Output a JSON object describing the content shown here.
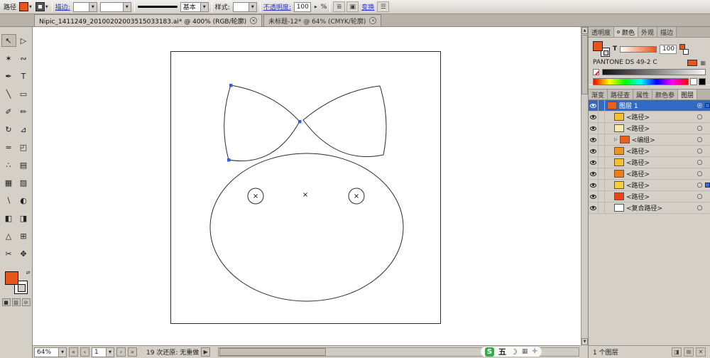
{
  "colors": {
    "accent": "#e8551a",
    "selection": "#316ac5",
    "anchor": "#2f62d2",
    "sogou_green": "#2fae47"
  },
  "icons": {
    "dd": "▼",
    "up": "▲",
    "down": "▼",
    "first": "«",
    "prev": "‹",
    "next": "›",
    "last": "»",
    "flyout": "▶",
    "swap": "⇄",
    "close": "×",
    "target": "○",
    "target_selected": "◎",
    "twisty": "▷",
    "grid": "▦",
    "gripper": "⋯",
    "spinner": "▶"
  },
  "control_bar": {
    "context_label": "路径",
    "stroke_link": "描边:",
    "brush_value": "基本",
    "style_label": "样式:",
    "opacity_link": "不透明度:",
    "opacity_value": "100",
    "opacity_unit": "%",
    "transform_link": "变换",
    "cb_icons": [
      {
        "name": "select-similar-icon",
        "glyph": "≣"
      },
      {
        "name": "document-setup-icon",
        "glyph": "▣"
      },
      {
        "name": "preferences-icon",
        "glyph": "☰"
      }
    ]
  },
  "doc_tabs": [
    {
      "label": "Nipic_1411249_20100202003515033183.ai* @ 400% (RGB/轮廓)",
      "active": true
    },
    {
      "label": "未标题-12* @ 64% (CMYK/轮廓)",
      "active": false
    }
  ],
  "toolbar": {
    "tools": [
      {
        "name": "selection-tool",
        "glyph": "↖",
        "active": true
      },
      {
        "name": "direct-selection-tool",
        "glyph": "▷"
      },
      {
        "name": "magic-wand-tool",
        "glyph": "✶"
      },
      {
        "name": "lasso-tool",
        "glyph": "∾"
      },
      {
        "name": "pen-tool",
        "glyph": "✒"
      },
      {
        "name": "type-tool",
        "glyph": "T"
      },
      {
        "name": "line-segment-tool",
        "glyph": "╲"
      },
      {
        "name": "rectangle-tool",
        "glyph": "▭"
      },
      {
        "name": "paintbrush-tool",
        "glyph": "✐"
      },
      {
        "name": "pencil-tool",
        "glyph": "✏"
      },
      {
        "name": "rotate-tool",
        "glyph": "↻"
      },
      {
        "name": "scale-tool",
        "glyph": "⊿"
      },
      {
        "name": "width-tool",
        "glyph": "≈"
      },
      {
        "name": "free-transform-tool",
        "glyph": "◰"
      },
      {
        "name": "symbol-sprayer-tool",
        "glyph": "∴"
      },
      {
        "name": "column-graph-tool",
        "glyph": "▤"
      },
      {
        "name": "mesh-tool",
        "glyph": "▦"
      },
      {
        "name": "gradient-tool",
        "glyph": "▨"
      },
      {
        "name": "eyedropper-tool",
        "glyph": "∖"
      },
      {
        "name": "blend-tool",
        "glyph": "◐"
      },
      {
        "name": "live-paint-bucket-tool",
        "glyph": "◧"
      },
      {
        "name": "live-paint-selection-tool",
        "glyph": "◨"
      },
      {
        "name": "perspective-grid-tool",
        "glyph": "△"
      },
      {
        "name": "artboard-tool",
        "glyph": "⊞"
      },
      {
        "name": "slice-tool",
        "glyph": "✂"
      },
      {
        "name": "hand-tool",
        "glyph": "✥"
      }
    ],
    "modes": [
      {
        "name": "color-mode-button",
        "glyph": "■"
      },
      {
        "name": "gradient-mode-button",
        "glyph": "▨"
      },
      {
        "name": "none-mode-button",
        "glyph": "⊘"
      }
    ]
  },
  "status_bar": {
    "zoom_value": "64%",
    "page_value": "1",
    "status_text": "19 次还原: 无重做"
  },
  "ime_bar": {
    "items": [
      {
        "name": "sogou-logo",
        "glyph": "S"
      },
      {
        "name": "ime-mode-label",
        "glyph": "五"
      },
      {
        "name": "moon-icon",
        "glyph": "☽"
      },
      {
        "name": "keyboard-icon",
        "glyph": "▦"
      },
      {
        "name": "toolbox-icon",
        "glyph": "✛"
      }
    ]
  },
  "right_panel": {
    "tabs_top": [
      {
        "label": "透明度",
        "key": "transparency"
      },
      {
        "label": "颜色",
        "key": "color",
        "active": true,
        "dot": true
      },
      {
        "label": "外观",
        "key": "appearance"
      },
      {
        "label": "描边",
        "key": "stroke"
      }
    ],
    "color_panel": {
      "tint_label": "T",
      "tint_value": "100",
      "swatch_name": "PANTONE DS 49-2 C"
    },
    "tabs_mid": [
      {
        "label": "渐变",
        "key": "gradient"
      },
      {
        "label": "路径查",
        "key": "pathfinder"
      },
      {
        "label": "属性",
        "key": "attributes"
      },
      {
        "label": "颜色参",
        "key": "color-guide"
      },
      {
        "label": "图层",
        "key": "layers",
        "active": true
      }
    ],
    "layers": {
      "rows": [
        {
          "name": "图层 1",
          "color": "#e8601c",
          "eye": true,
          "selected": true,
          "selbox": true,
          "top": true
        },
        {
          "name": "<路径>",
          "color": "#f6c12f",
          "eye": true
        },
        {
          "name": "<路径>",
          "color": "#f8e9ae",
          "eye": true
        },
        {
          "name": "<编组>",
          "color": "#e8601c",
          "eye": true,
          "twisty": true
        },
        {
          "name": "<路径>",
          "color": "#f2921e",
          "eye": true
        },
        {
          "name": "<路径>",
          "color": "#f6c12f",
          "eye": true
        },
        {
          "name": "<路径>",
          "color": "#ef7d1a",
          "eye": true
        },
        {
          "name": "<路径>",
          "color": "#f6cf3f",
          "eye": true,
          "selbox": true
        },
        {
          "name": "<路径>",
          "color": "#e8451c",
          "eye": true
        },
        {
          "name": "<复合路径>",
          "color": "#ffffff",
          "eye": true
        }
      ],
      "footer_text": "1 个图层",
      "footer_icons": [
        {
          "name": "make-mask-icon",
          "glyph": "◨"
        },
        {
          "name": "new-layer-icon",
          "glyph": "⊞"
        },
        {
          "name": "delete-layer-icon",
          "glyph": "✕"
        }
      ]
    }
  }
}
